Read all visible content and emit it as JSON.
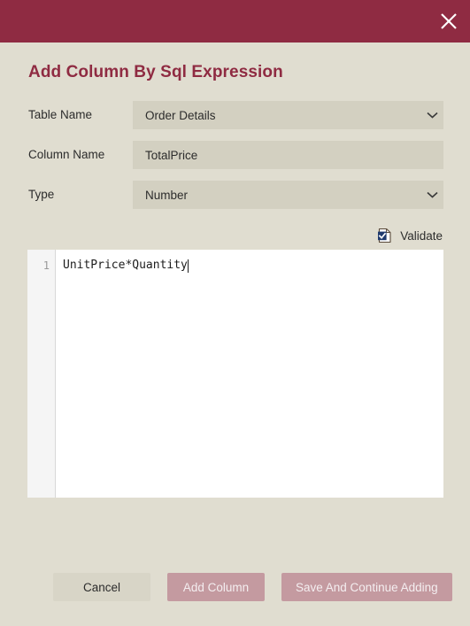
{
  "theme": {
    "titlebar_color": "#8f2b42",
    "dialog_background": "#e0ddd0",
    "field_background": "#d3d0c1",
    "accent_color": "#8f2b42",
    "primary_button_color": "#c49aa0",
    "cancel_button_color": "#d8d5c7",
    "editor_background": "#ffffff",
    "gutter_background": "#f5f5f5"
  },
  "titlebar": {
    "close_icon": "close-icon",
    "close_label": "Close"
  },
  "dialog": {
    "heading": "Add Column By Sql Expression"
  },
  "form": {
    "fields": [
      {
        "label": "Table Name",
        "value": "Order Details",
        "control": "dropdown",
        "icon": "chevron-down-icon"
      },
      {
        "label": "Column Name",
        "value": "TotalPrice",
        "placeholder": "",
        "control": "text-input",
        "icon": ""
      },
      {
        "label": "Type",
        "value": "Number",
        "control": "dropdown",
        "icon": "chevron-down-icon"
      }
    ]
  },
  "toolbar": {
    "validate_label": "Validate",
    "validate_icon": "document-check-icon"
  },
  "editor": {
    "line_numbers": [
      "1"
    ],
    "lines": [
      "UnitPrice*Quantity"
    ],
    "caret_visible": true
  },
  "footer": {
    "buttons": [
      {
        "label": "Cancel",
        "style": "secondary"
      },
      {
        "label": "Add Column",
        "style": "primary"
      },
      {
        "label": "Save And Continue Adding",
        "style": "primary"
      }
    ]
  }
}
